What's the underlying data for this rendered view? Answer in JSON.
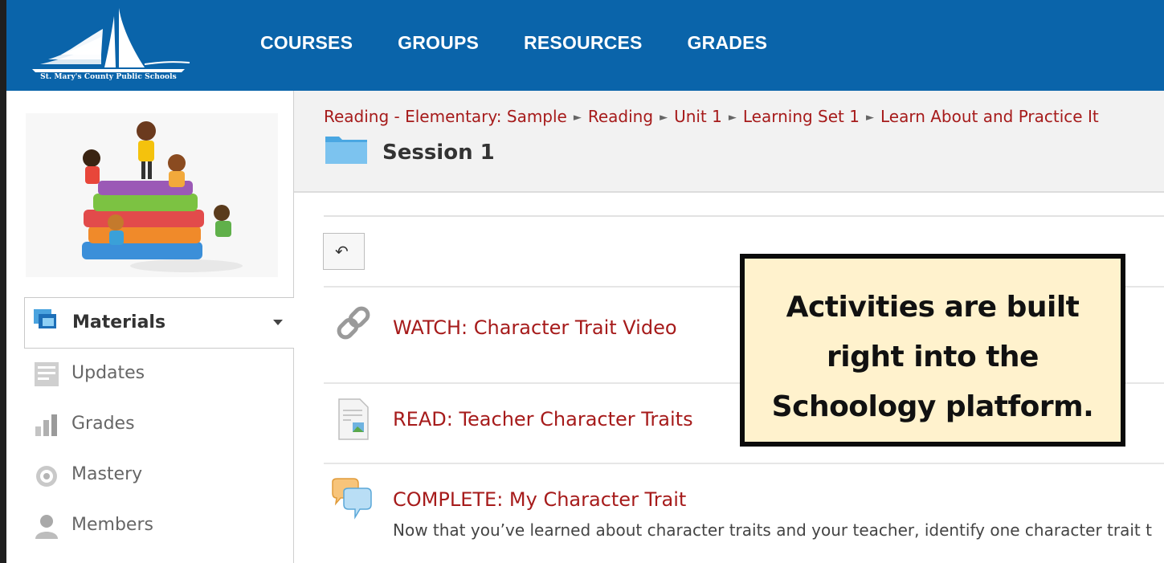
{
  "header": {
    "logo_text": "St. Mary's County Public Schools",
    "nav": [
      "COURSES",
      "GROUPS",
      "RESOURCES",
      "GRADES"
    ]
  },
  "sidebar": {
    "materials_label": "Materials",
    "items": [
      {
        "label": "Updates",
        "icon": "updates-icon"
      },
      {
        "label": "Grades",
        "icon": "grades-icon"
      },
      {
        "label": "Mastery",
        "icon": "mastery-icon"
      },
      {
        "label": "Members",
        "icon": "members-icon"
      }
    ]
  },
  "breadcrumb": [
    "Reading - Elementary: Sample",
    "Reading",
    "Unit 1",
    "Learning Set 1",
    "Learn About and Practice It"
  ],
  "page_title": "Session 1",
  "items": [
    {
      "title": "WATCH: Character Trait Video",
      "icon": "link-icon"
    },
    {
      "title": "READ: Teacher Character Traits",
      "icon": "page-icon"
    },
    {
      "title": "COMPLETE: My Character Trait",
      "icon": "discussion-icon",
      "description": "Now that you’ve learned about character traits and your teacher, identify one character trait t"
    }
  ],
  "callout": {
    "lines": [
      "Activities are built",
      "right into the",
      "Schoology platform."
    ]
  },
  "colors": {
    "header": "#0a64aa",
    "link": "#a61b1b",
    "callout_bg": "#fff2cd"
  }
}
